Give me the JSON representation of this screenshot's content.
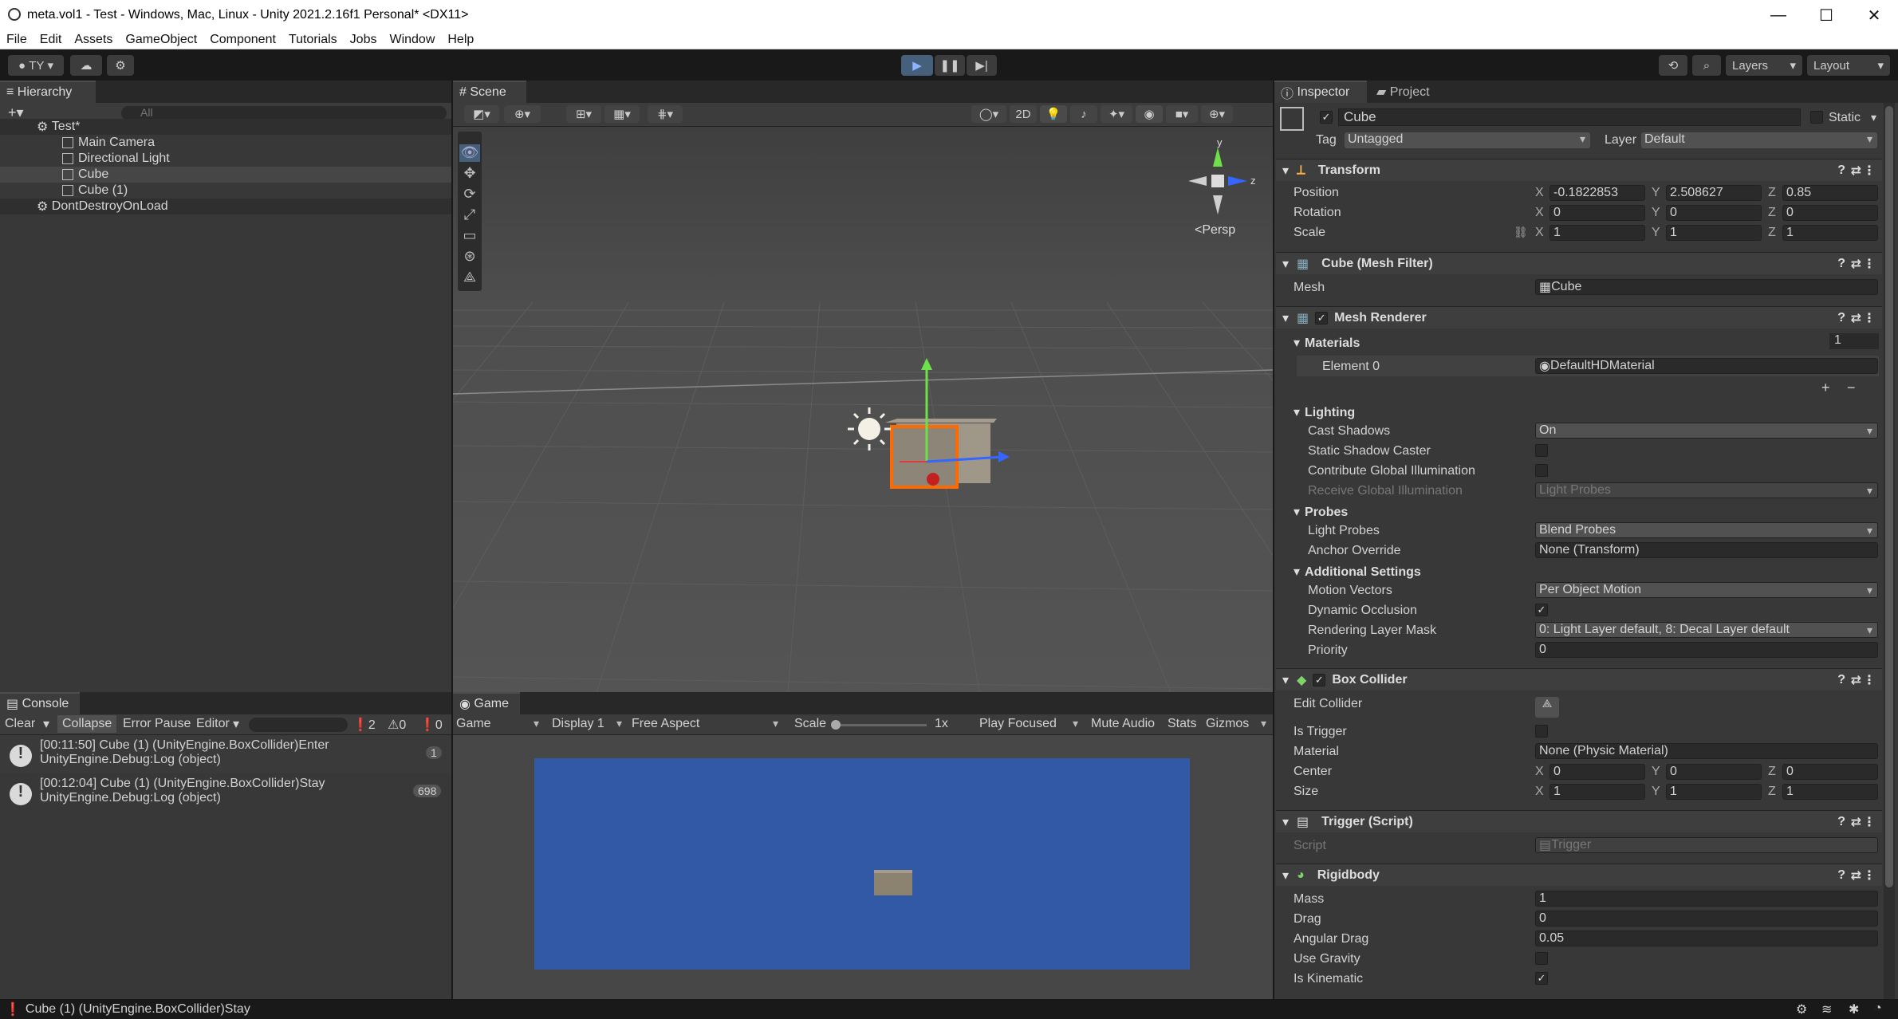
{
  "window": {
    "title": "meta.vol1 - Test - Windows, Mac, Linux - Unity 2021.2.16f1 Personal* <DX11>",
    "min": "—",
    "max": "☐",
    "close": "✕"
  },
  "menu": [
    "File",
    "Edit",
    "Assets",
    "GameObject",
    "Component",
    "Tutorials",
    "Jobs",
    "Window",
    "Help"
  ],
  "toolbar": {
    "account": "TY",
    "layers": "Layers",
    "layout": "Layout"
  },
  "hierarchy": {
    "tab": "Hierarchy",
    "search_placeholder": "All",
    "scene": "Test*",
    "items": [
      "Main Camera",
      "Directional Light",
      "Cube",
      "Cube (1)"
    ],
    "dontdestroy": "DontDestroyOnLoad"
  },
  "scene": {
    "tab": "Scene",
    "btn2d": "2D",
    "persp": "<Persp",
    "gizmo_y": "y",
    "gizmo_z": "z"
  },
  "game": {
    "tab": "Game",
    "display_mode": "Game",
    "display": "Display 1",
    "aspect": "Free Aspect",
    "scale_label": "Scale",
    "scale_value": "1x",
    "play_focused": "Play Focused",
    "mute": "Mute Audio",
    "stats": "Stats",
    "gizmos": "Gizmos"
  },
  "console": {
    "tab": "Console",
    "clear": "Clear",
    "collapse": "Collapse",
    "error_pause": "Error Pause",
    "editor": "Editor",
    "count_info": "2",
    "count_warn": "0",
    "count_err": "0",
    "logs": [
      {
        "line1": "[00:11:50] Cube (1) (UnityEngine.BoxCollider)Enter",
        "line2": "UnityEngine.Debug:Log (object)",
        "count": "1"
      },
      {
        "line1": "[00:12:04] Cube (1) (UnityEngine.BoxCollider)Stay",
        "line2": "UnityEngine.Debug:Log (object)",
        "count": "698"
      }
    ]
  },
  "status": {
    "text": "Cube (1) (UnityEngine.BoxCollider)Stay"
  },
  "inspector": {
    "tab": "Inspector",
    "project_tab": "Project",
    "name": "Cube",
    "static": "Static",
    "tag_label": "Tag",
    "tag": "Untagged",
    "layer_label": "Layer",
    "layer": "Default",
    "transform": {
      "title": "Transform",
      "position_label": "Position",
      "rotation_label": "Rotation",
      "scale_label": "Scale",
      "position": [
        "-0.1822853",
        "2.508627",
        "0.85"
      ],
      "rotation": [
        "0",
        "0",
        "0"
      ],
      "scale": [
        "1",
        "1",
        "1"
      ],
      "axes": [
        "X",
        "Y",
        "Z"
      ]
    },
    "mesh_filter": {
      "title": "Cube (Mesh Filter)",
      "mesh_label": "Mesh",
      "mesh": "Cube"
    },
    "mesh_renderer": {
      "title": "Mesh Renderer",
      "materials_label": "Materials",
      "materials_count": "1",
      "element_label": "Element 0",
      "element": "DefaultHDMaterial",
      "plus": "+",
      "minus": "−",
      "lighting": "Lighting",
      "cast_shadows_label": "Cast Shadows",
      "cast_shadows": "On",
      "static_shadow_label": "Static Shadow Caster",
      "contribute_gi_label": "Contribute Global Illumination",
      "receive_gi_label": "Receive Global Illumination",
      "receive_gi": "Light Probes",
      "probes": "Probes",
      "light_probes_label": "Light Probes",
      "light_probes": "Blend Probes",
      "anchor_label": "Anchor Override",
      "anchor": "None (Transform)",
      "additional": "Additional Settings",
      "motion_label": "Motion Vectors",
      "motion": "Per Object Motion",
      "dyn_occ_label": "Dynamic Occlusion",
      "rlm_label": "Rendering Layer Mask",
      "rlm": "0: Light Layer default, 8: Decal Layer default",
      "priority_label": "Priority",
      "priority": "0"
    },
    "box_collider": {
      "title": "Box Collider",
      "edit_label": "Edit Collider",
      "trigger_label": "Is Trigger",
      "material_label": "Material",
      "material": "None (Physic Material)",
      "center_label": "Center",
      "center": [
        "0",
        "0",
        "0"
      ],
      "size_label": "Size",
      "size": [
        "1",
        "1",
        "1"
      ]
    },
    "trigger_script": {
      "title": "Trigger (Script)",
      "script_label": "Script",
      "script": "Trigger"
    },
    "rigidbody": {
      "title": "Rigidbody",
      "mass_label": "Mass",
      "mass": "1",
      "drag_label": "Drag",
      "drag": "0",
      "angular_label": "Angular Drag",
      "angular": "0.05",
      "gravity_label": "Use Gravity",
      "kinematic_label": "Is Kinematic"
    }
  },
  "colors": {
    "selection": "#2c5d87",
    "game_bg": "#3159a5",
    "accent": "#4c7dff"
  }
}
